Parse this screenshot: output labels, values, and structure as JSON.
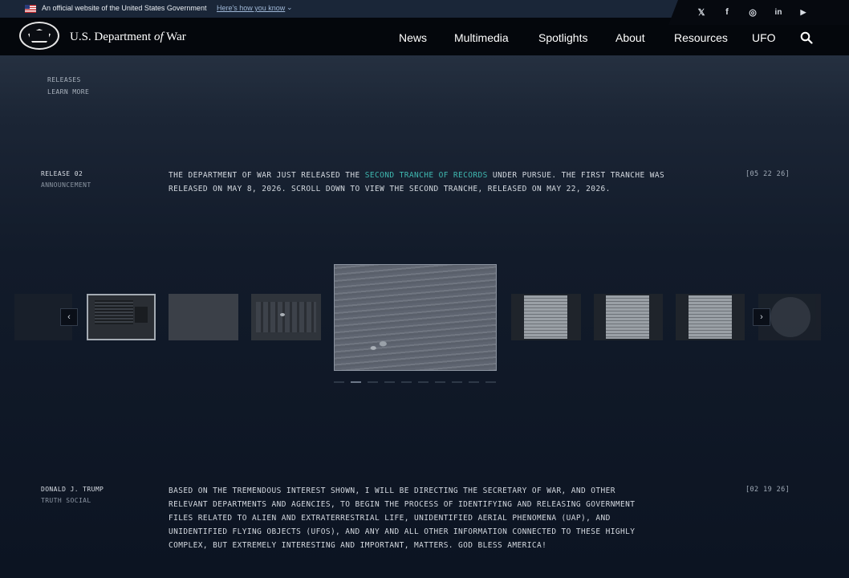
{
  "gov_banner": {
    "official_text": "An official website of the United States Government",
    "how_link": "Here's how you know"
  },
  "social": {
    "x": "𝕏",
    "facebook": "f",
    "instagram": "◎",
    "linkedin": "in",
    "youtube": "▶"
  },
  "header": {
    "brand_prefix": "U.S. Department ",
    "brand_of": "of",
    "brand_suffix": " War",
    "nav": [
      "News",
      "Multimedia",
      "Spotlights",
      "About",
      "Resources",
      "UFO"
    ]
  },
  "subnav": {
    "releases": "RELEASES",
    "learn_more": "LEARN MORE"
  },
  "release": {
    "title": "RELEASE 02",
    "subtitle": "ANNOUNCEMENT",
    "text_before": "THE DEPARTMENT OF WAR JUST RELEASED THE ",
    "link_text": "SECOND TRANCHE OF RECORDS",
    "text_after": " UNDER PURSUE. THE FIRST TRANCHE WAS RELEASED ON MAY 8, 2026. SCROLL DOWN TO VIEW THE SECOND TRANCHE, RELEASED ON MAY 22, 2026.",
    "date": "[05 22 26]"
  },
  "carousel": {
    "prev_label": "‹",
    "next_label": "›",
    "active_index": 1,
    "dot_count": 10
  },
  "statement": {
    "author": "DONALD J. TRUMP",
    "source": "TRUTH SOCIAL",
    "text": "BASED ON THE TREMENDOUS INTEREST SHOWN, I WILL BE DIRECTING THE SECRETARY OF WAR, AND OTHER RELEVANT DEPARTMENTS AND AGENCIES, TO BEGIN THE PROCESS OF IDENTIFYING AND RELEASING GOVERNMENT FILES RELATED TO ALIEN AND EXTRATERRESTRIAL LIFE, UNIDENTIFIED AERIAL PHENOMENA (UAP), AND UNIDENTIFIED FLYING OBJECTS (UFOS), AND ANY AND ALL OTHER INFORMATION CONNECTED TO THESE HIGHLY COMPLEX, BUT EXTREMELY INTERESTING AND IMPORTANT, MATTERS. GOD BLESS AMERICA!",
    "date": "[02 19 26]"
  },
  "colors": {
    "accent_link": "#3fb8b0",
    "header_bg": "#04070c",
    "banner_bg": "#1a2638"
  }
}
